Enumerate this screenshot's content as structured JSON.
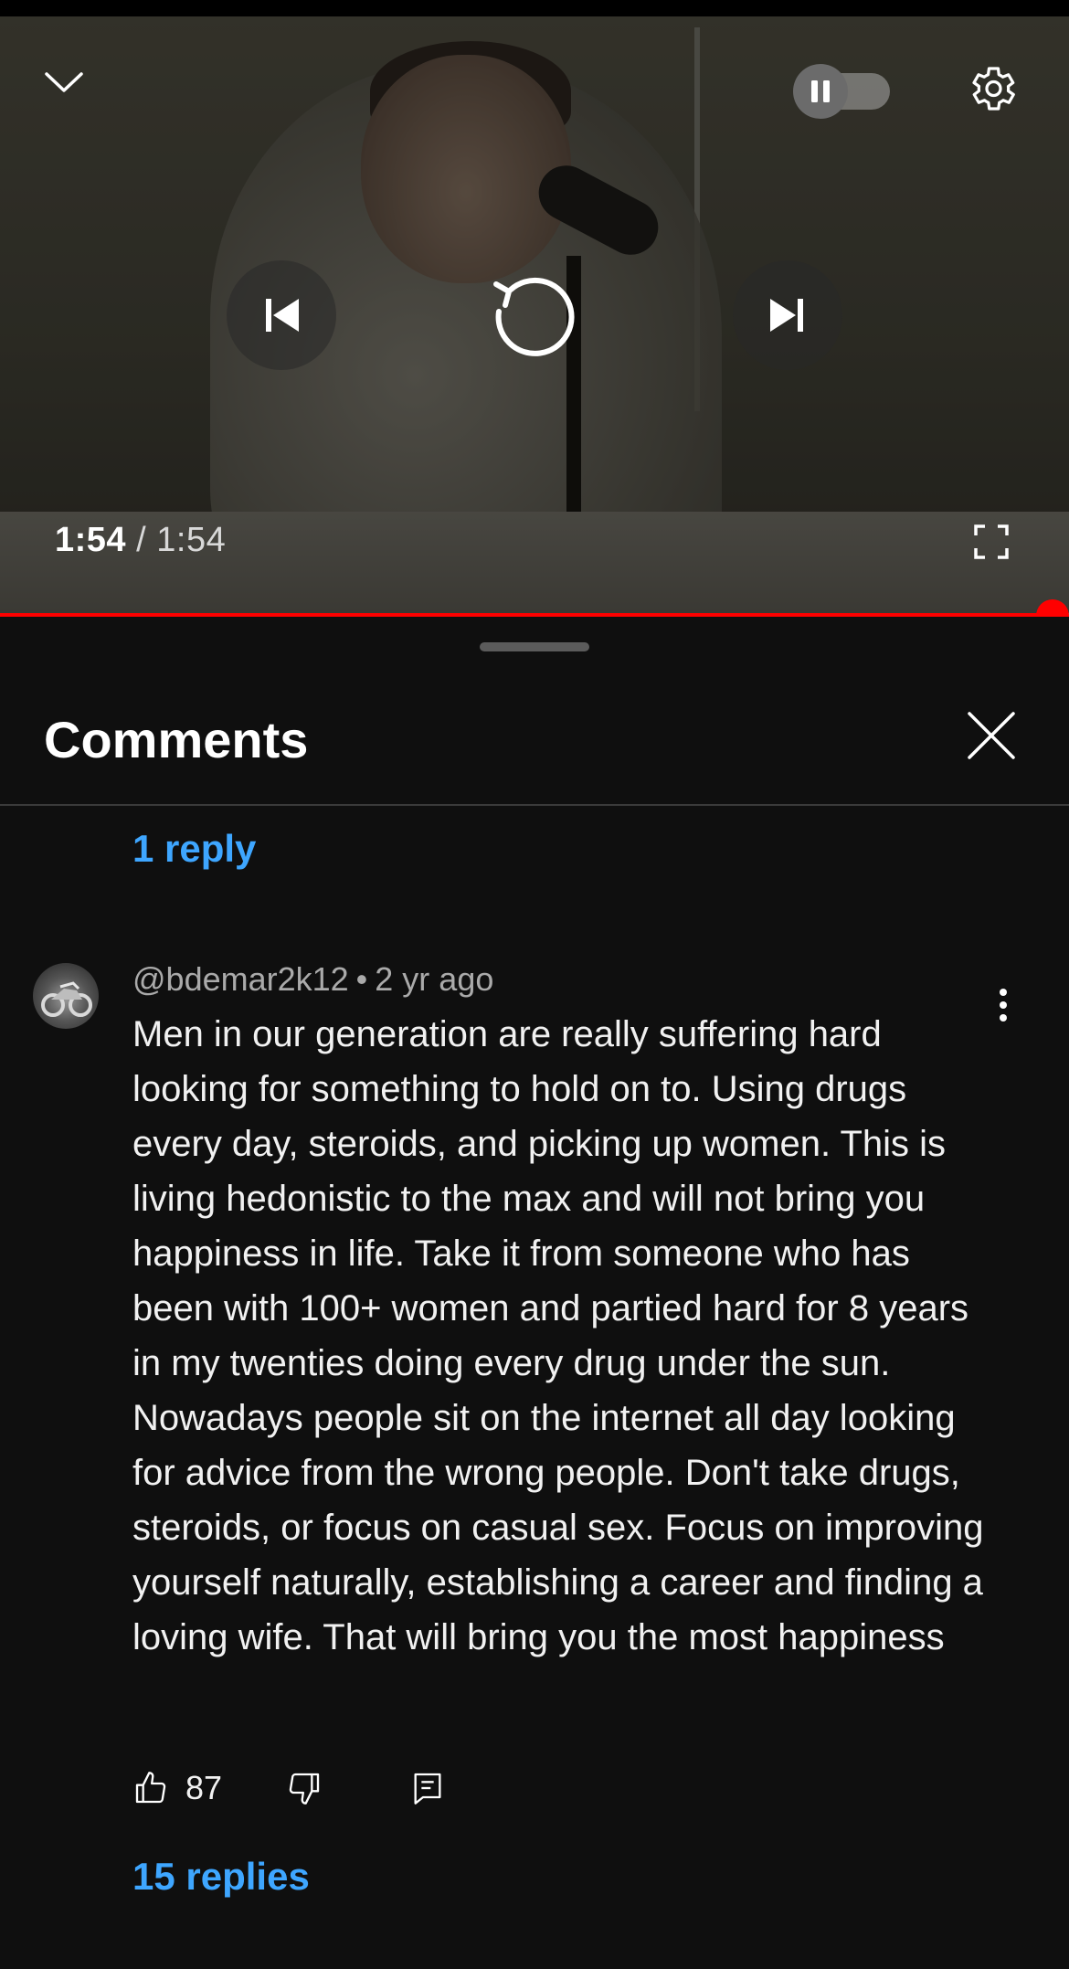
{
  "player": {
    "current_time": "1:54",
    "separator": "/",
    "duration": "1:54",
    "progress_fraction": 0.985,
    "accent_color": "#ff0000"
  },
  "icons": {
    "collapse": "chevron-down-icon",
    "autoplay": "pause-icon",
    "settings": "gear-icon",
    "previous": "skip-previous-icon",
    "replay": "replay-icon",
    "next": "skip-next-icon",
    "fullscreen": "fullscreen-icon",
    "close": "close-icon",
    "more": "more-vert-icon",
    "like": "thumb-up-icon",
    "dislike": "thumb-down-icon",
    "reply": "reply-icon"
  },
  "comments_panel": {
    "title": "Comments",
    "previous_thread_replies": "1 reply",
    "comment": {
      "author": "@bdemar2k12",
      "age": "2 yr ago",
      "text": "Men in our generation are really suffering hard looking for something to hold on to. Using drugs every day, steroids, and picking up women. This is living hedonistic to the max and will not bring you happiness in life. Take it from someone who has been with 100+ women and partied hard for 8 years in my twenties doing every drug under the sun. Nowadays people sit on the internet all day looking for advice from the wrong people. Don't take drugs, steroids, or focus on casual sex. Focus on improving yourself naturally, establishing a career and finding a loving wife. That will bring you the most happiness",
      "likes": "87",
      "replies_label": "15 replies"
    },
    "link_color": "#3ea6ff"
  }
}
